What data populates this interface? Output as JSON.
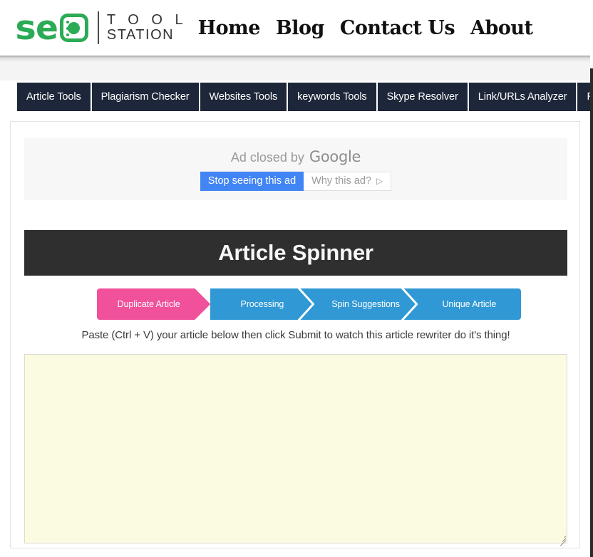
{
  "header": {
    "logo": {
      "brand_s": "s",
      "brand_e": "e",
      "brand_o_icon": "gear-molecule-icon",
      "word_tool": "T O O L",
      "word_station": "STATION",
      "color": "#2bab55"
    },
    "nav": [
      {
        "label": "Home"
      },
      {
        "label": "Blog"
      },
      {
        "label": "Contact Us"
      },
      {
        "label": "About"
      }
    ]
  },
  "subnav": {
    "background": "#1e2739",
    "items": [
      {
        "label": "Article Tools"
      },
      {
        "label": "Plagiarism Checker"
      },
      {
        "label": "Websites Tools"
      },
      {
        "label": "keywords Tools"
      },
      {
        "label": "Skype Resolver"
      },
      {
        "label": "Link/URLs Analyzer"
      },
      {
        "label": "Ranke"
      }
    ]
  },
  "ad": {
    "closed_text": "Ad closed by",
    "provider": "Google",
    "stop_button": "Stop seeing this ad",
    "why_button": "Why this ad?",
    "why_icon": "play-triangle-icon",
    "stop_button_color": "#4285f4"
  },
  "main": {
    "title": "Article Spinner",
    "title_background": "#2f2f2f",
    "steps": [
      {
        "label": "Duplicate Article",
        "state": "active",
        "color": "#f0519a"
      },
      {
        "label": "Processing",
        "state": "inactive",
        "color": "#3098d4"
      },
      {
        "label": "Spin Suggestions",
        "state": "inactive",
        "color": "#3098d4"
      },
      {
        "label": "Unique Article",
        "state": "inactive",
        "color": "#3098d4"
      }
    ],
    "instruction": "Paste (Ctrl + V) your article below then click Submit to watch this article rewriter do it's thing!",
    "textarea": {
      "value": "",
      "placeholder": "",
      "background": "#fbfbe2"
    }
  }
}
